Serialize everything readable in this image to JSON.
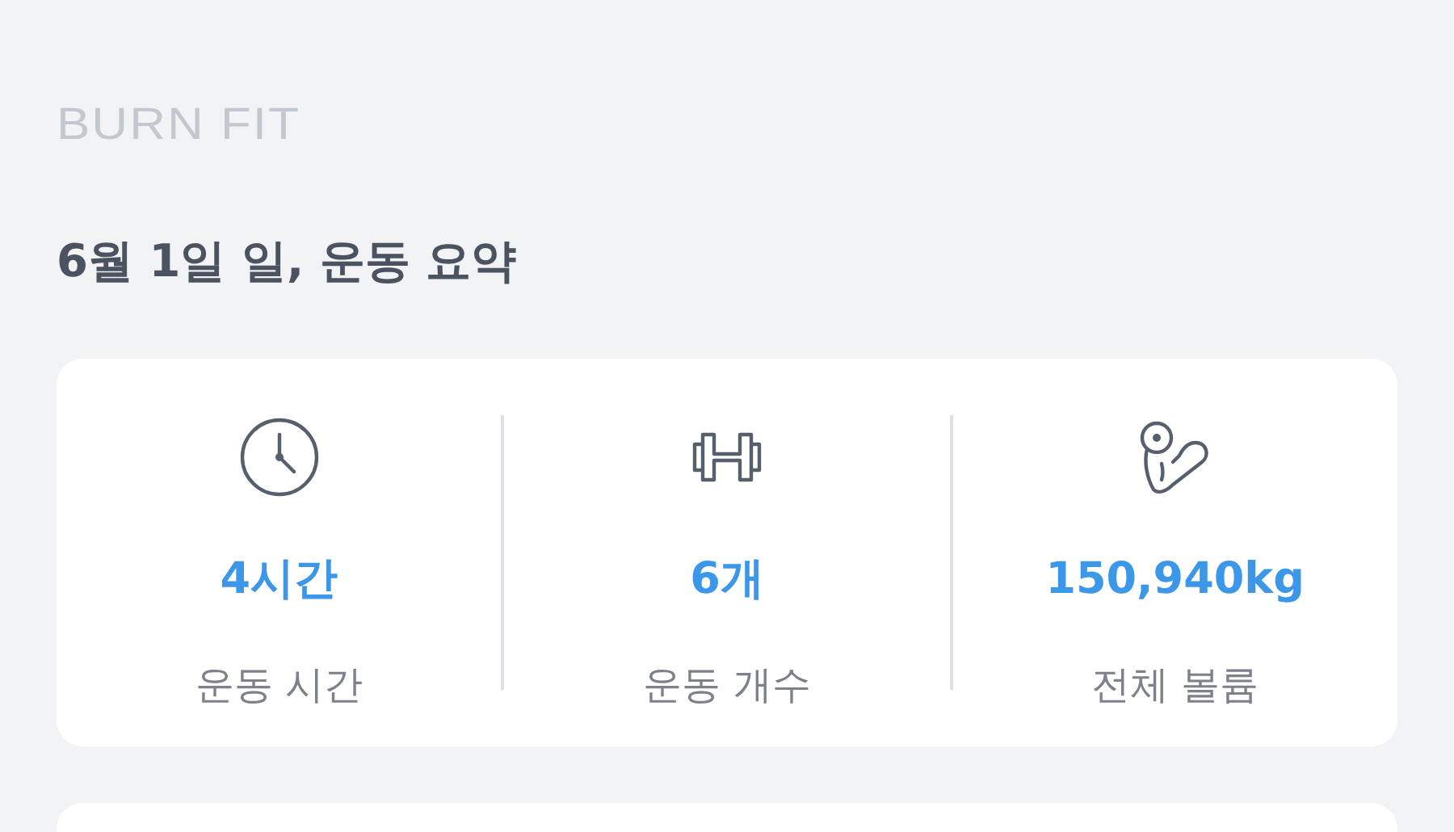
{
  "logo": "BURN FIT",
  "title": "6월 1일 일, 운동 요약",
  "stats": [
    {
      "kind": "time",
      "value": "4시간",
      "label": "운동 시간"
    },
    {
      "kind": "count",
      "value": "6개",
      "label": "운동 개수"
    },
    {
      "kind": "volume",
      "value": "150,940kg",
      "label": "전체 볼륨"
    }
  ]
}
